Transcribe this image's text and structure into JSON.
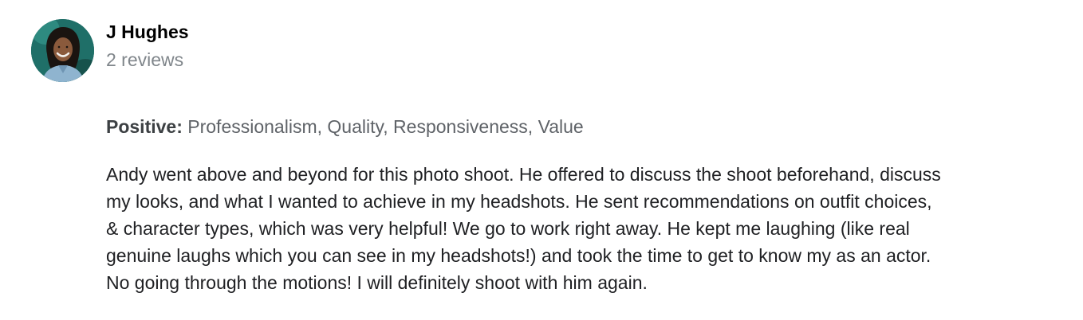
{
  "reviewer": {
    "name": "J Hughes",
    "review_count": "2 reviews",
    "avatar_icon": "user-photo-icon"
  },
  "positive": {
    "label": "Positive:",
    "values": "Professionalism, Quality, Responsiveness, Value"
  },
  "review": {
    "lines": [
      "Andy went above and beyond for this photo shoot. He offered to discuss the shoot beforehand, discuss",
      "my looks, and what I wanted to achieve in my headshots. He sent recommendations on outfit choices,",
      "& character types, which was very helpful! We go to work right away. He kept me laughing (like real",
      "genuine laughs which you can see in my headshots!) and took the time to get to know my as an actor.",
      "No going through the motions! I will definitely shoot with him again."
    ]
  },
  "colors": {
    "name": "#000000",
    "meta": "#80868b",
    "body_text": "#202124",
    "avatar_background": "#1f6f68"
  }
}
